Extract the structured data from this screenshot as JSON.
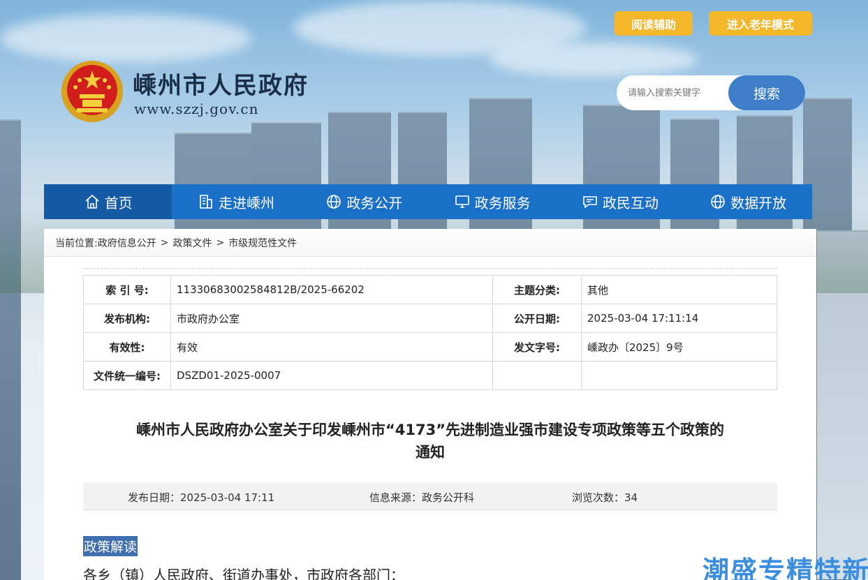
{
  "header": {
    "reading_aid": "阅读辅助",
    "elder_mode": "进入老年模式",
    "site_title": "嵊州市人民政府",
    "site_url": "www.szzj.gov.cn",
    "search_placeholder": "请输入搜索关键字",
    "search_button": "搜索"
  },
  "nav": {
    "items": [
      {
        "label": "首页",
        "icon": "home-icon"
      },
      {
        "label": "走进嵊州",
        "icon": "building-icon"
      },
      {
        "label": "政务公开",
        "icon": "globe-icon"
      },
      {
        "label": "政务服务",
        "icon": "monitor-icon"
      },
      {
        "label": "政民互动",
        "icon": "chat-icon"
      },
      {
        "label": "数据开放",
        "icon": "globe-icon"
      }
    ]
  },
  "breadcrumb": {
    "prefix": "当前位置:",
    "items": [
      "政府信息公开",
      "政策文件",
      "市级规范性文件"
    ],
    "separator": ">"
  },
  "meta": {
    "rows": [
      {
        "l1": "索 引 号:",
        "v1": "11330683002584812B/2025-66202",
        "l2": "主题分类:",
        "v2": "其他"
      },
      {
        "l1": "发布机构:",
        "v1": "市政府办公室",
        "l2": "公开日期:",
        "v2": "2025-03-04 17:11:14"
      },
      {
        "l1": "有效性:",
        "v1": "有效",
        "l2": "发文字号:",
        "v2": " 嵊政办〔2025〕9号"
      },
      {
        "l1": "文件统一编号:",
        "v1": "DSZD01-2025-0007",
        "l2": "",
        "v2": ""
      }
    ]
  },
  "document": {
    "title_line1": "嵊州市人民政府办公室关于印发嵊州市“4173”先进制造业强市建设专项政策等五个政策的",
    "title_line2": "通知",
    "publish_date": "发布日期：2025-03-04 17:11",
    "source": "信息来源：政务公开科",
    "views": "浏览次数：34",
    "interpretation": "政策解读",
    "salutation": "各乡（镇）人民政府、街道办事处，市政府各部门："
  },
  "watermark": "潮盛专精特新",
  "colors": {
    "accent_yellow": "#f5b72a",
    "nav_blue": "#1a6fc6",
    "search_blue": "#3e7dc8"
  }
}
